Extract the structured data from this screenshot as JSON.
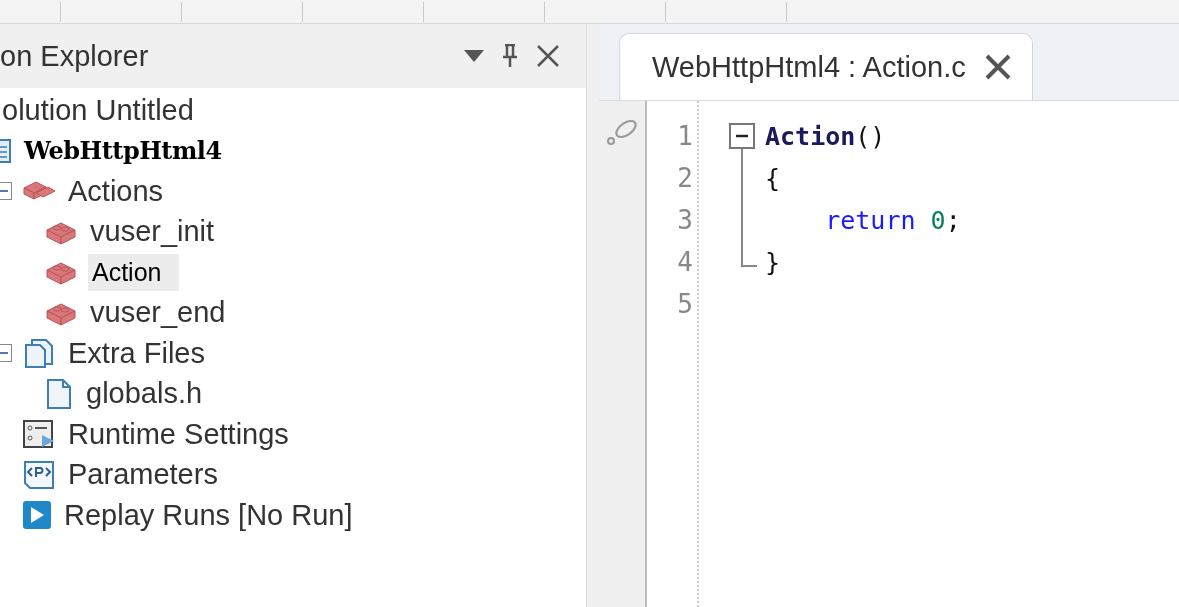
{
  "explorer": {
    "title": "on Explorer",
    "tree": [
      {
        "label": "olution Untitled",
        "kind": "solution",
        "children": [
          {
            "label": "WebHttpHtml4",
            "kind": "project",
            "children": [
              {
                "label": "Actions",
                "kind": "actions",
                "expanded": true,
                "selected": false,
                "children": [
                  {
                    "label": "vuser_init",
                    "kind": "action",
                    "selected": false
                  },
                  {
                    "label": "Action",
                    "kind": "action",
                    "selected": true
                  },
                  {
                    "label": "vuser_end",
                    "kind": "action",
                    "selected": false
                  }
                ]
              },
              {
                "label": "Extra Files",
                "kind": "files",
                "expanded": true,
                "selected": false,
                "children": [
                  {
                    "label": "globals.h",
                    "kind": "file",
                    "selected": false
                  }
                ]
              },
              {
                "label": "Runtime Settings",
                "kind": "settings",
                "selected": false
              },
              {
                "label": "Parameters",
                "kind": "parameters",
                "selected": false
              },
              {
                "label": "Replay Runs [No Run]",
                "kind": "replay",
                "selected": false
              }
            ]
          }
        ]
      }
    ]
  },
  "editor": {
    "tabs": [
      {
        "label": "WebHttpHtml4 : Action.c",
        "selected": true
      }
    ],
    "lines": [
      {
        "number": "1",
        "foldable": true,
        "expanded": true,
        "in_block": false,
        "tokens": [
          {
            "kind": "function",
            "text": "Action"
          },
          {
            "kind": "plain",
            "text": "()"
          }
        ]
      },
      {
        "number": "2",
        "foldable": false,
        "in_block": true,
        "tokens": [
          {
            "kind": "plain",
            "text": "{"
          }
        ]
      },
      {
        "number": "3",
        "foldable": false,
        "in_block": true,
        "tokens": [
          {
            "kind": "keyword",
            "text": "    return"
          },
          {
            "kind": "number",
            "text": " 0"
          },
          {
            "kind": "plain",
            "text": ";"
          }
        ]
      },
      {
        "number": "4",
        "foldable": false,
        "in_block": true,
        "tokens": [
          {
            "kind": "plain",
            "text": "}"
          }
        ]
      },
      {
        "number": "5",
        "foldable": false,
        "in_block": false
      }
    ]
  }
}
